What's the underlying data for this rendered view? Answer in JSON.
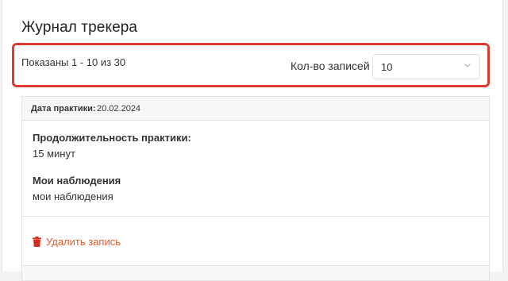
{
  "page": {
    "title": "Журнал трекера"
  },
  "pagination": {
    "showing": "Показаны 1 - 10 из 30",
    "per_page_label": "Кол-во записей",
    "per_page_value": "10"
  },
  "entry": {
    "date_label": "Дата практики:",
    "date_value": "20.02.2024",
    "duration_label": "Продолжительность практики:",
    "duration_value": "15 минут",
    "notes_label": "Мои наблюдения",
    "notes_value": "мои наблюдения",
    "delete_label": "Удалить запись"
  },
  "colors": {
    "highlight": "#e03a32",
    "danger": "#ea5a2d",
    "trash_icon": "#d9291c"
  },
  "icons": {
    "chevron": "chevron-down-icon",
    "trash": "trash-icon"
  }
}
